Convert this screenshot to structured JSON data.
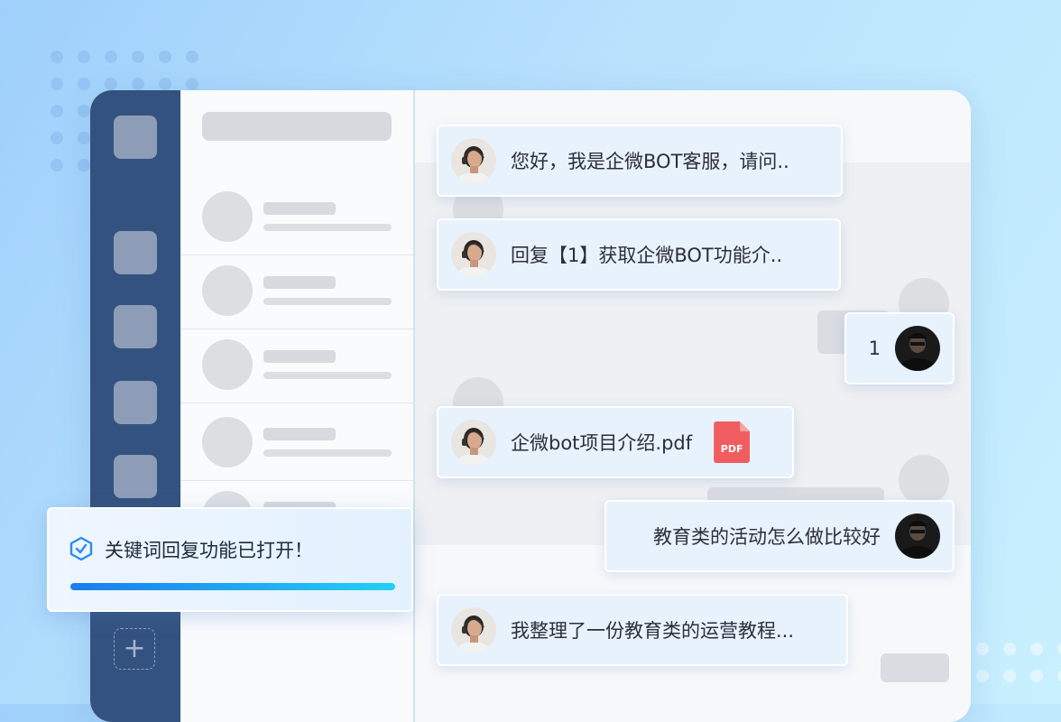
{
  "messages": [
    {
      "from": "bot",
      "text": "您好，我是企微BOT客服，请问.."
    },
    {
      "from": "bot",
      "text": "回复【1】获取企微BOT功能介.."
    },
    {
      "from": "user",
      "text": "1"
    },
    {
      "from": "bot",
      "text": "企微bot项目介绍.pdf",
      "attachment_icon": "pdf-file-icon",
      "attachment_label": "PDF"
    },
    {
      "from": "user",
      "text": "教育类的活动怎么做比较好"
    },
    {
      "from": "bot",
      "text": "我整理了一份教育类的运营教程..."
    }
  ],
  "toast": {
    "text": "关键词回复功能已打开！",
    "icon": "shield-check-icon",
    "progress": 1.0
  },
  "sidebar": {
    "add_icon": "plus-icon"
  },
  "colors": {
    "sidebar_bg": "#34527f",
    "bubble_bg": "#e8f2fd",
    "pdf_red": "#f05d60",
    "progress_start": "#1a7cf0",
    "progress_end": "#23d0f5",
    "toast_icon": "#2a8cf5"
  }
}
